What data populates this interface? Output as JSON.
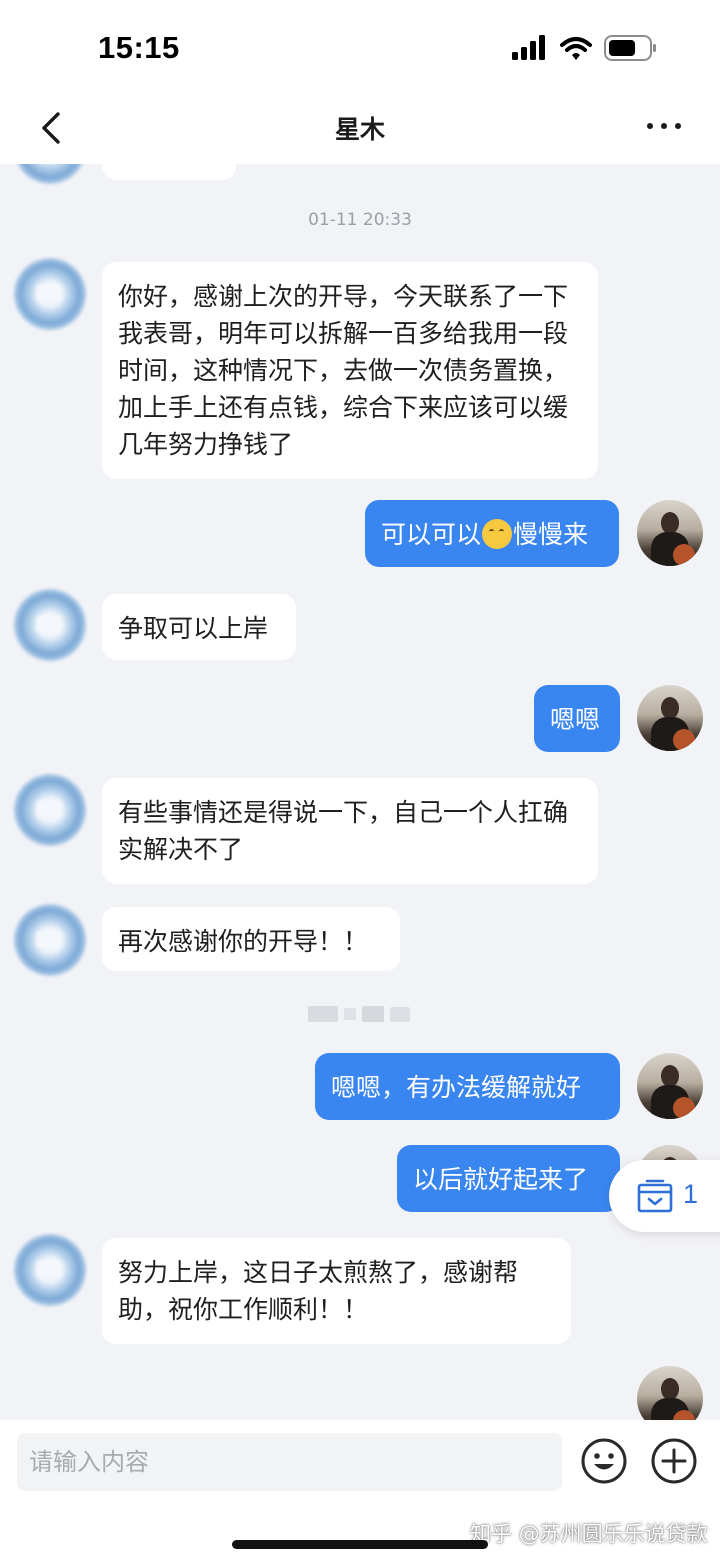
{
  "status_bar": {
    "time": "15:15"
  },
  "header": {
    "title": "星木"
  },
  "messages": [
    {
      "type": "timestamp",
      "text": "01-11 20:33"
    },
    {
      "sender": "other",
      "text": "你好，感谢上次的开导，今天联系了一下我表哥，明年可以拆解一百多给我用一段时间，这种情况下，去做一次债务置换，加上手上还有点钱，综合下来应该可以缓几年努力挣钱了"
    },
    {
      "sender": "me",
      "text_before": "可以可以",
      "emoji": "hugging-face",
      "text_after": "慢慢来"
    },
    {
      "sender": "other",
      "text": "争取可以上岸"
    },
    {
      "sender": "me",
      "text": "嗯嗯"
    },
    {
      "sender": "other",
      "text": "有些事情还是得说一下，自己一个人扛确实解决不了"
    },
    {
      "sender": "other",
      "text": "再次感谢你的开导！！"
    },
    {
      "sender": "me",
      "text": "嗯嗯，有办法缓解就好"
    },
    {
      "sender": "me",
      "text": "以后就好起来了"
    },
    {
      "sender": "other",
      "text": "努力上岸，这日子太煎熬了，感谢帮助，祝你工作顺利！！"
    }
  ],
  "floating_badge": {
    "icon": "inbox-check-icon",
    "count": "1"
  },
  "input": {
    "placeholder": "请输入内容"
  },
  "watermark": "知乎 @苏州圆乐乐说贷款",
  "colors": {
    "outgoing_bubble": "#3a86f0",
    "incoming_bubble": "#ffffff",
    "background": "#f2f3f7",
    "accent": "#2f6fd6"
  }
}
